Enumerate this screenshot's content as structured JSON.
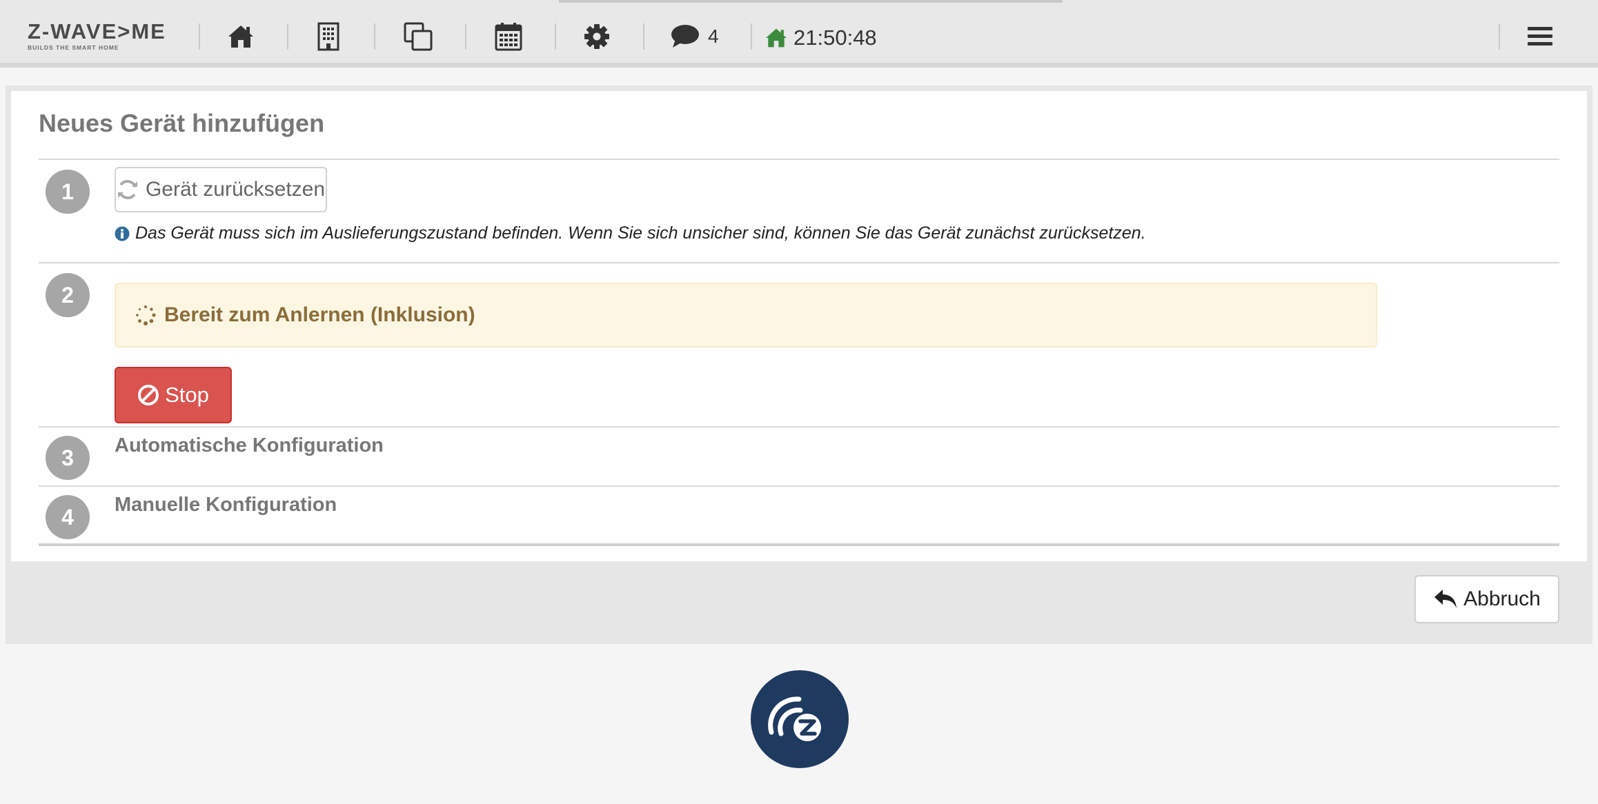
{
  "navbar": {
    "logo_main": "Z-WAVE>ME",
    "logo_sub": "BUILDS THE SMART HOME",
    "icons": {
      "home": "home-icon",
      "rooms": "building-icon",
      "elements": "copy-icon",
      "events": "calendar-icon",
      "settings": "gear-icon",
      "messages": "comment-icon",
      "menu": "hamburger-icon"
    },
    "message_count": "4",
    "clock": "21:50:48"
  },
  "panel": {
    "title": "Neues Gerät hinzufügen",
    "steps": [
      {
        "number": "1"
      },
      {
        "number": "2"
      },
      {
        "number": "3",
        "label": "Automatische Konfiguration"
      },
      {
        "number": "4",
        "label": "Manuelle Konfiguration"
      }
    ],
    "reset_button": "Gerät zurücksetzen",
    "reset_hint": "Das Gerät muss sich im Auslieferungszustand befinden. Wenn Sie sich unsicher sind, können Sie das Gerät zunächst zurücksetzen.",
    "inclusion_status": "Bereit zum Anlernen (Inklusion)",
    "stop_button": "Stop",
    "cancel_button": "Abbruch"
  },
  "colors": {
    "navbar_bg": "#e8e8e8",
    "step_badge": "#a6a6a6",
    "warning_bg": "#fcf6e3",
    "warning_text": "#8a6d3b",
    "danger": "#d9534f",
    "clock_home": "#3c8a3c",
    "brand_logo": "#1f3a5f"
  }
}
